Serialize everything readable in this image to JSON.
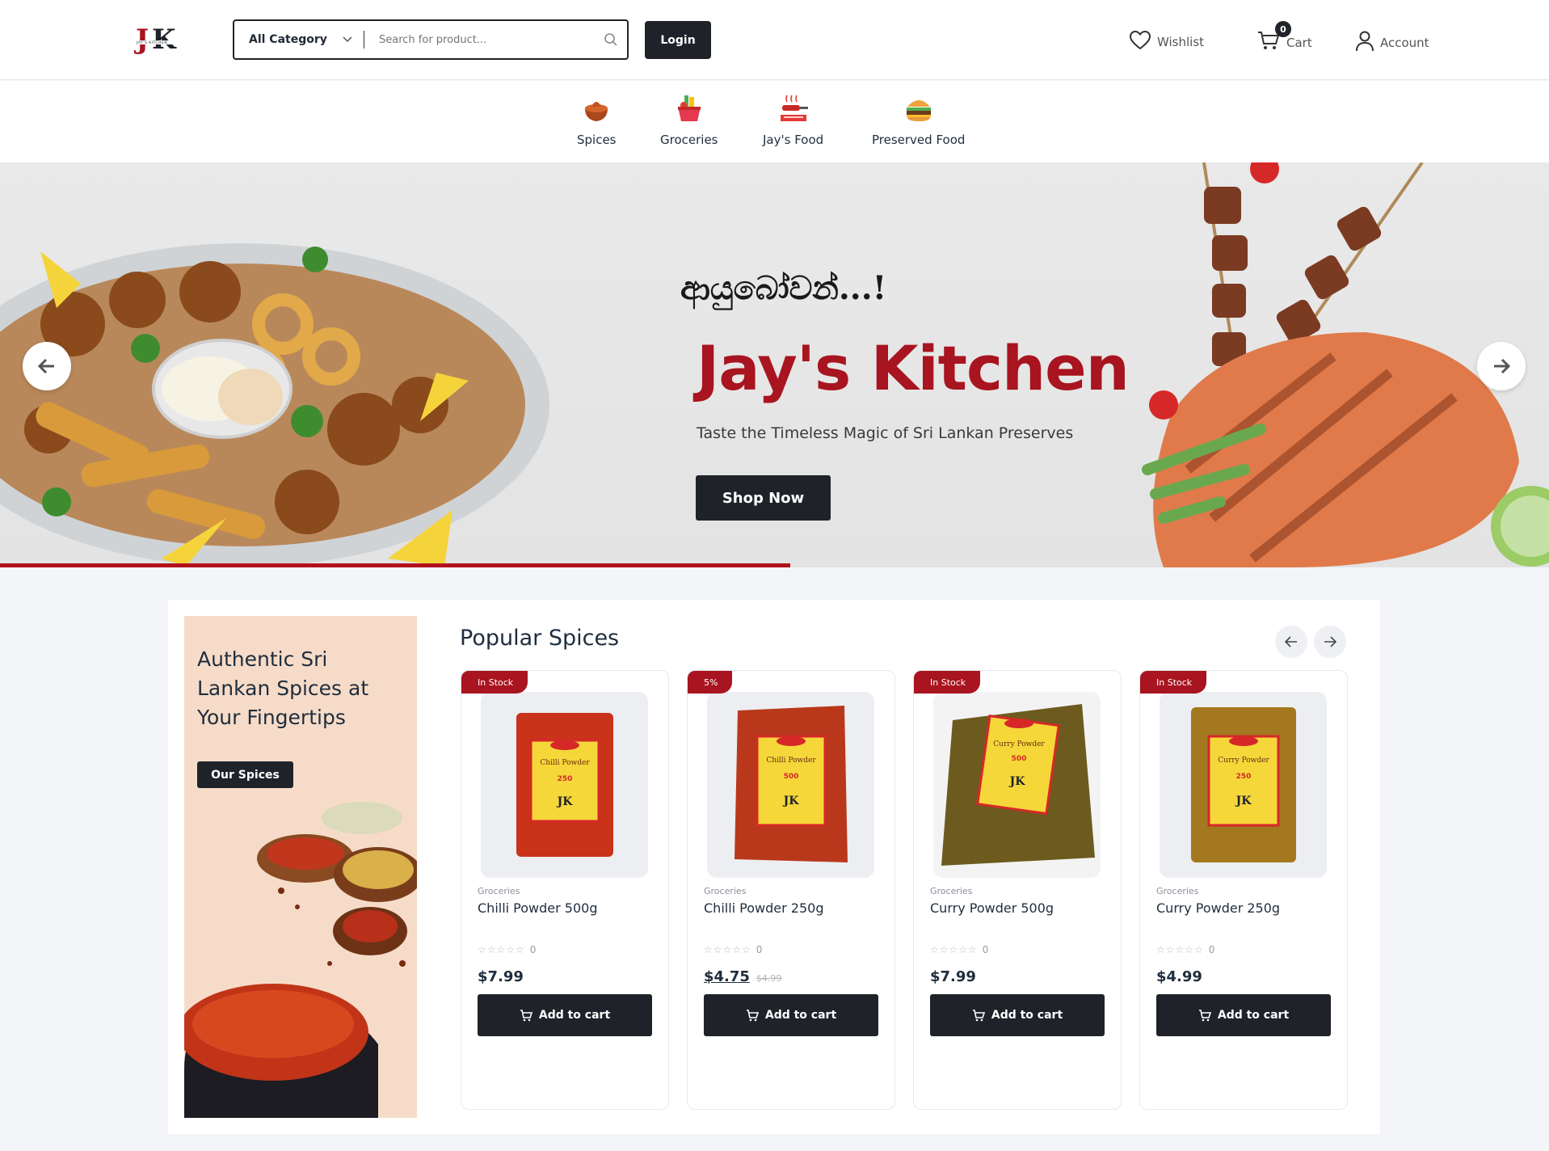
{
  "header": {
    "logo_text": "JK",
    "logo_sub": "JAY'S KITCHEN",
    "category_select": "All Category",
    "search_placeholder": "Search for product...",
    "login_label": "Login",
    "wishlist_label": "Wishlist",
    "cart_label": "Cart",
    "cart_count": "0",
    "account_label": "Account"
  },
  "categories": [
    {
      "label": "Spices",
      "icon": "spices-icon"
    },
    {
      "label": "Groceries",
      "icon": "groceries-icon"
    },
    {
      "label": "Jay's Food",
      "icon": "jays-food-icon"
    },
    {
      "label": "Preserved Food",
      "icon": "preserved-food-icon"
    }
  ],
  "hero": {
    "greeting": "ආයුබෝවන්...!",
    "title": "Jay's Kitchen",
    "subtitle": "Taste the Timeless Magic of Sri Lankan Preserves",
    "cta": "Shop Now",
    "progress": 0.51
  },
  "promo": {
    "title": "Authentic Sri Lankan Spices at Your Fingertips",
    "cta": "Our Spices"
  },
  "section": {
    "title": "Popular Spices"
  },
  "products": [
    {
      "badge": "In Stock",
      "category": "Groceries",
      "name": "Chilli Powder 500g",
      "rating_count": "0",
      "price": "$7.99",
      "old_price": "",
      "button": "Add to cart",
      "pack_label": "Chilli Powder",
      "weight": "250",
      "color": "#c8331a"
    },
    {
      "badge": "5%",
      "category": "Groceries",
      "name": "Chilli Powder 250g",
      "rating_count": "0",
      "price": "$4.75",
      "old_price": "$4.99",
      "button": "Add to cart",
      "pack_label": "Chilli Powder",
      "weight": "500",
      "color": "#b9381c"
    },
    {
      "badge": "In Stock",
      "category": "Groceries",
      "name": "Curry Powder 500g",
      "rating_count": "0",
      "price": "$7.99",
      "old_price": "",
      "button": "Add to cart",
      "pack_label": "Curry Powder",
      "weight": "500",
      "color": "#6d5a1e"
    },
    {
      "badge": "In Stock",
      "category": "Groceries",
      "name": "Curry Powder 250g",
      "rating_count": "0",
      "price": "$4.99",
      "old_price": "",
      "button": "Add to cart",
      "pack_label": "Curry Powder",
      "weight": "250",
      "color": "#a4781f"
    }
  ],
  "colors": {
    "brand": "#a8141f",
    "dark": "#1f2329",
    "promo_bg": "#f6dcc8"
  }
}
